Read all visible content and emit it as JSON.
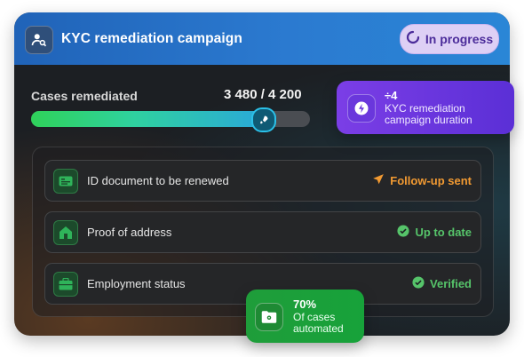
{
  "header": {
    "title": "KYC remediation campaign",
    "status": "In progress"
  },
  "progress": {
    "label": "Cases remediated",
    "count_text": "3 480 / 4 200",
    "completed": 3480,
    "total": 4200
  },
  "items": [
    {
      "label": "ID document to be renewed",
      "status": "Follow-up sent",
      "status_icon": "send-icon",
      "status_color": "#f29a32",
      "icon": "id-card-icon"
    },
    {
      "label": "Proof of address",
      "status": "Up to date",
      "status_icon": "check-circle-icon",
      "status_color": "#56c46a",
      "icon": "home-icon"
    },
    {
      "label": "Employment status",
      "status": "Verified",
      "status_icon": "check-circle-icon",
      "status_color": "#56c46a",
      "icon": "briefcase-icon"
    }
  ],
  "stat_duration": {
    "value": "÷4",
    "desc": "KYC remediation campaign duration",
    "icon": "lightning-icon"
  },
  "stat_automation": {
    "value": "70%",
    "desc": "Of cases automated",
    "icon": "folder-gear-icon"
  },
  "colors": {
    "header_blue": "#2b7ad0",
    "status_purple": "#4b2c9a",
    "progress_green": "#2fd15a",
    "progress_cyan": "#2aa9d8",
    "accent_purple": "#7b3ee6",
    "accent_green": "#1f9d3a",
    "warning_orange": "#f29a32",
    "success_green": "#56c46a"
  }
}
